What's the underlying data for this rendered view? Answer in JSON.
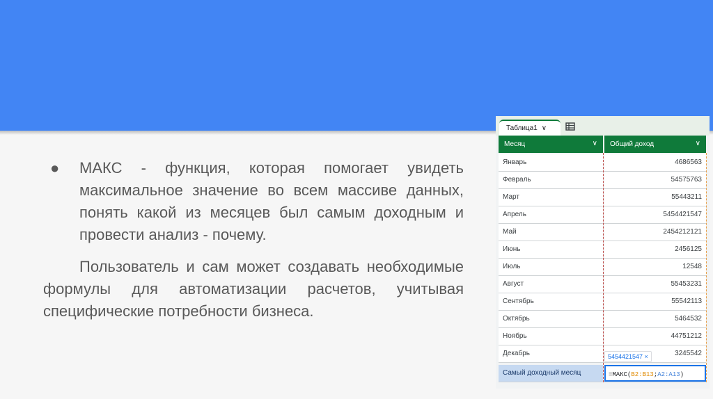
{
  "slide": {
    "bullet_marker": "●",
    "bullet_text": "МАКС - функция, которая помогает увидеть максимальное значение во всем массиве данных, понять какой из месяцев был самым доходным и провести анализ - почему.",
    "paragraph": "Пользователь и сам  может создавать необходимые формулы для автоматизации расчетов, учитывая специфические потребности бизнеса."
  },
  "sheet": {
    "tab_label": "Таблица1",
    "tab_chevron": "∨",
    "columns": [
      "Месяц",
      "Общий доход"
    ],
    "rows": [
      {
        "month": "Январь",
        "income": "4686563"
      },
      {
        "month": "Февраль",
        "income": "54575763"
      },
      {
        "month": "Март",
        "income": "55443211"
      },
      {
        "month": "Апрель",
        "income": "5454421547"
      },
      {
        "month": "Май",
        "income": "2454212121"
      },
      {
        "month": "Июнь",
        "income": "2456125"
      },
      {
        "month": "Июль",
        "income": "12548"
      },
      {
        "month": "Август",
        "income": "55453231"
      },
      {
        "month": "Сентябрь",
        "income": "55542113"
      },
      {
        "month": "Октябрь",
        "income": "5464532"
      },
      {
        "month": "Ноябрь",
        "income": "44751212"
      },
      {
        "month": "Декабрь",
        "income": "3245542"
      }
    ],
    "summary_label": "Самый доходный месяц",
    "formula_prefix": "=МАКС(",
    "formula_ref1": "B2:B13",
    "formula_sep": ";",
    "formula_ref2": "A2:A13",
    "formula_suffix": ")",
    "tooltip": "5454421547 ×"
  },
  "colors": {
    "banner": "#4285f4",
    "header_green": "#0f7a3a",
    "summary_fill": "#c6d9f1"
  }
}
